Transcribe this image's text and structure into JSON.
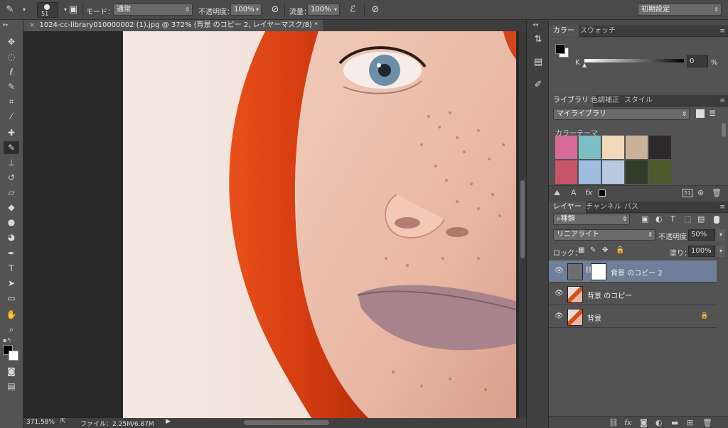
{
  "options_bar": {
    "brush_size": "51",
    "mode_label": "モード：",
    "mode_value": "通常",
    "opacity_label": "不透明度：",
    "opacity_value": "100%",
    "flow_label": "流量：",
    "flow_value": "100%",
    "workspace_value": "初期設定"
  },
  "document": {
    "tab_title": "1024-cc-library010000002 (1).jpg @ 372% (背景 のコピー 2, レイヤーマスク/8) *",
    "zoom_status": "371.58%",
    "file_info": "ファイル：2.25M/6.87M"
  },
  "color_panel": {
    "tabs": [
      "カラー",
      "スウォッチ"
    ],
    "channel_label": "K",
    "value": "0",
    "unit": "%"
  },
  "library_panel": {
    "tabs": [
      "ライブラリ",
      "色調補正",
      "スタイル"
    ],
    "library_select": "マイライブラリ",
    "section_label": "カラーテーマ",
    "swatches_row1": [
      "#d76b98",
      "#7bbfc4",
      "#f3d9bb",
      "#c9b299",
      "#2d2829"
    ],
    "swatches_row2": [
      "#c85469",
      "#9fbde0",
      "#b7c9de",
      "#303d28",
      "#4c5a2d"
    ],
    "badge": "51"
  },
  "layers_panel": {
    "tabs": [
      "レイヤー",
      "チャンネル",
      "パス"
    ],
    "filter_label": "種類",
    "blend_mode": "リニアライト",
    "opacity_label": "不透明度：",
    "opacity_value": "50%",
    "lock_label": "ロック：",
    "fill_label": "塗り：",
    "fill_value": "100%",
    "layers": [
      {
        "name": "背景 のコピー 2"
      },
      {
        "name": "背景 のコピー"
      },
      {
        "name": "背景"
      }
    ]
  },
  "colors": {
    "selected_layer": "#6f7f9a",
    "foreground": "#000000",
    "background": "#ffffff"
  }
}
